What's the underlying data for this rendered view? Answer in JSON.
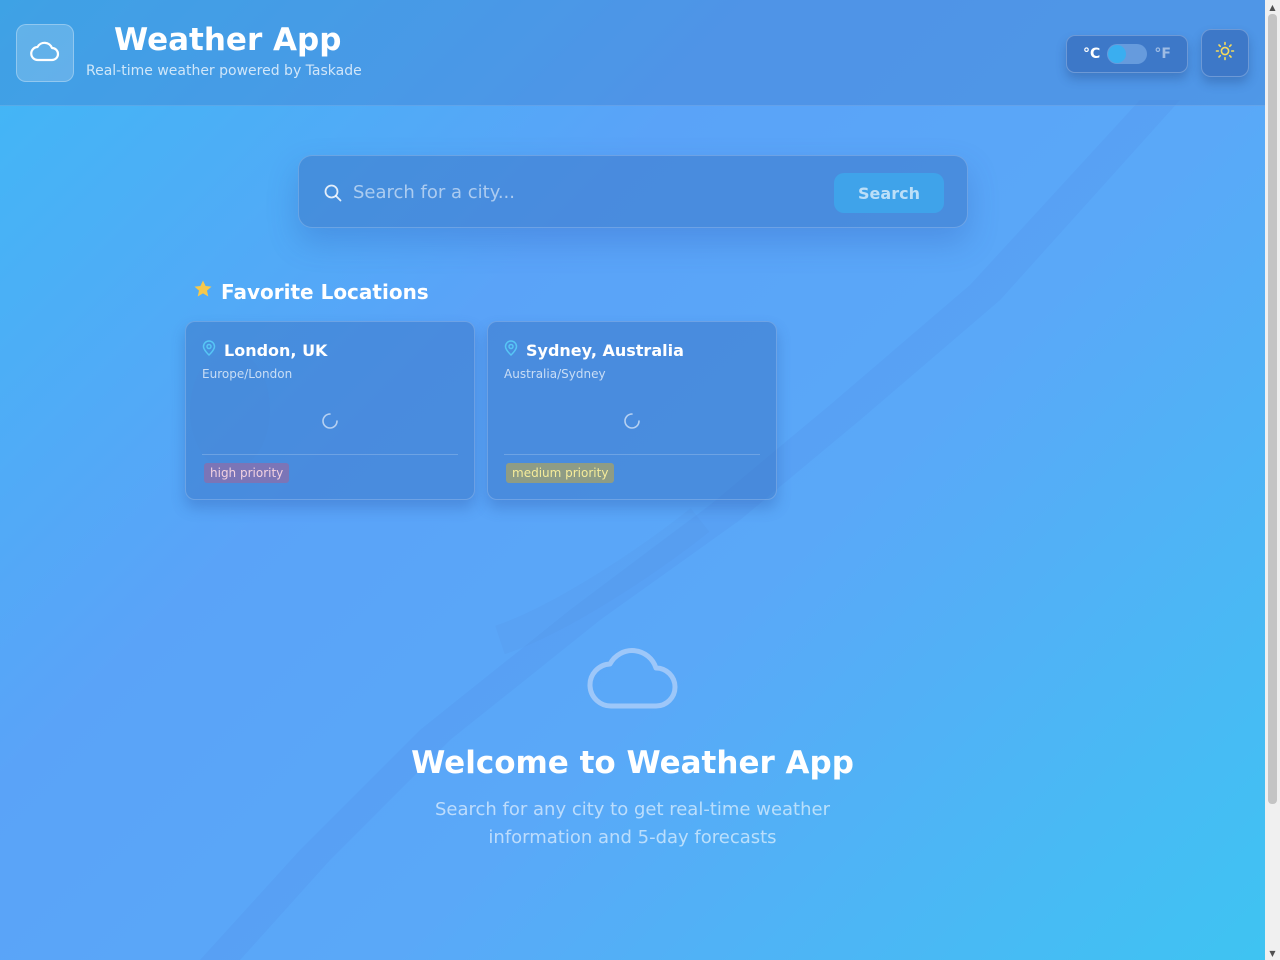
{
  "header": {
    "title": "Weather App",
    "subtitle": "Real-time weather powered by Taskade",
    "logo_icon": "cloud-icon",
    "unit_toggle": {
      "celsius_label": "°C",
      "fahrenheit_label": "°F",
      "selected": "°C"
    },
    "theme_icon": "sun-icon"
  },
  "search": {
    "placeholder": "Search for a city...",
    "value": "",
    "button_label": "Search",
    "icon": "search-icon"
  },
  "favorites": {
    "heading": "Favorite Locations",
    "heading_icon": "star-icon",
    "items": [
      {
        "name": "London, UK",
        "timezone": "Europe/London",
        "priority": "high priority",
        "icon": "map-pin-icon",
        "status": "loading"
      },
      {
        "name": "Sydney, Australia",
        "timezone": "Australia/Sydney",
        "priority": "medium priority",
        "icon": "map-pin-icon",
        "status": "loading"
      }
    ]
  },
  "welcome": {
    "icon": "cloud-icon",
    "title": "Welcome to Weather App",
    "text": "Search for any city to get real-time weather information and 5-day forecasts"
  },
  "colors": {
    "accent": "#3fa3ea",
    "sun": "#f7dc5a",
    "star": "#f5c84c",
    "pin": "#57c6f5"
  }
}
